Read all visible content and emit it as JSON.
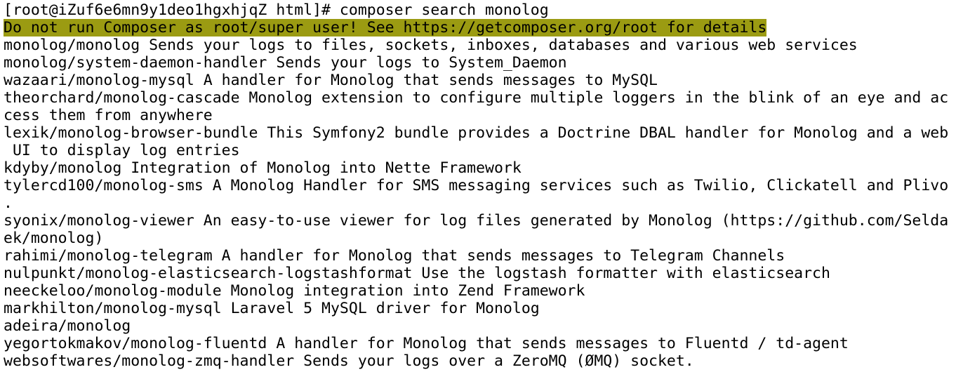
{
  "terminal": {
    "prompt": "[root@iZuf6e6mn9y1deo1hgxhjqZ html]# composer search monolog",
    "warning": "Do not run Composer as root/super user! See https://getcomposer.org/root for details",
    "warning_bg": "#9b9b12",
    "lines": [
      "monolog/monolog Sends your logs to files, sockets, inboxes, databases and various web services",
      "monolog/system-daemon-handler Sends your logs to System_Daemon",
      "wazaari/monolog-mysql A handler for Monolog that sends messages to MySQL",
      "theorchard/monolog-cascade Monolog extension to configure multiple loggers in the blink of an eye and ac",
      "cess them from anywhere",
      "lexik/monolog-browser-bundle This Symfony2 bundle provides a Doctrine DBAL handler for Monolog and a web",
      " UI to display log entries",
      "kdyby/monolog Integration of Monolog into Nette Framework",
      "tylercd100/monolog-sms A Monolog Handler for SMS messaging services such as Twilio, Clickatell and Plivo",
      ".",
      "syonix/monolog-viewer An easy-to-use viewer for log files generated by Monolog (https://github.com/Selda",
      "ek/monolog)",
      "rahimi/monolog-telegram A handler for Monolog that sends messages to Telegram Channels",
      "nulpunkt/monolog-elasticsearch-logstashformat Use the logstash formatter with elasticsearch",
      "neeckeloo/monolog-module Monolog integration into Zend Framework",
      "markhilton/monolog-mysql Laravel 5 MySQL driver for Monolog",
      "adeira/monolog",
      "yegortokmakov/monolog-fluentd A handler for Monolog that sends messages to Fluentd / td-agent",
      "websoftwares/monolog-zmq-handler Sends your logs over a ZeroMQ (ØMQ) socket."
    ]
  }
}
